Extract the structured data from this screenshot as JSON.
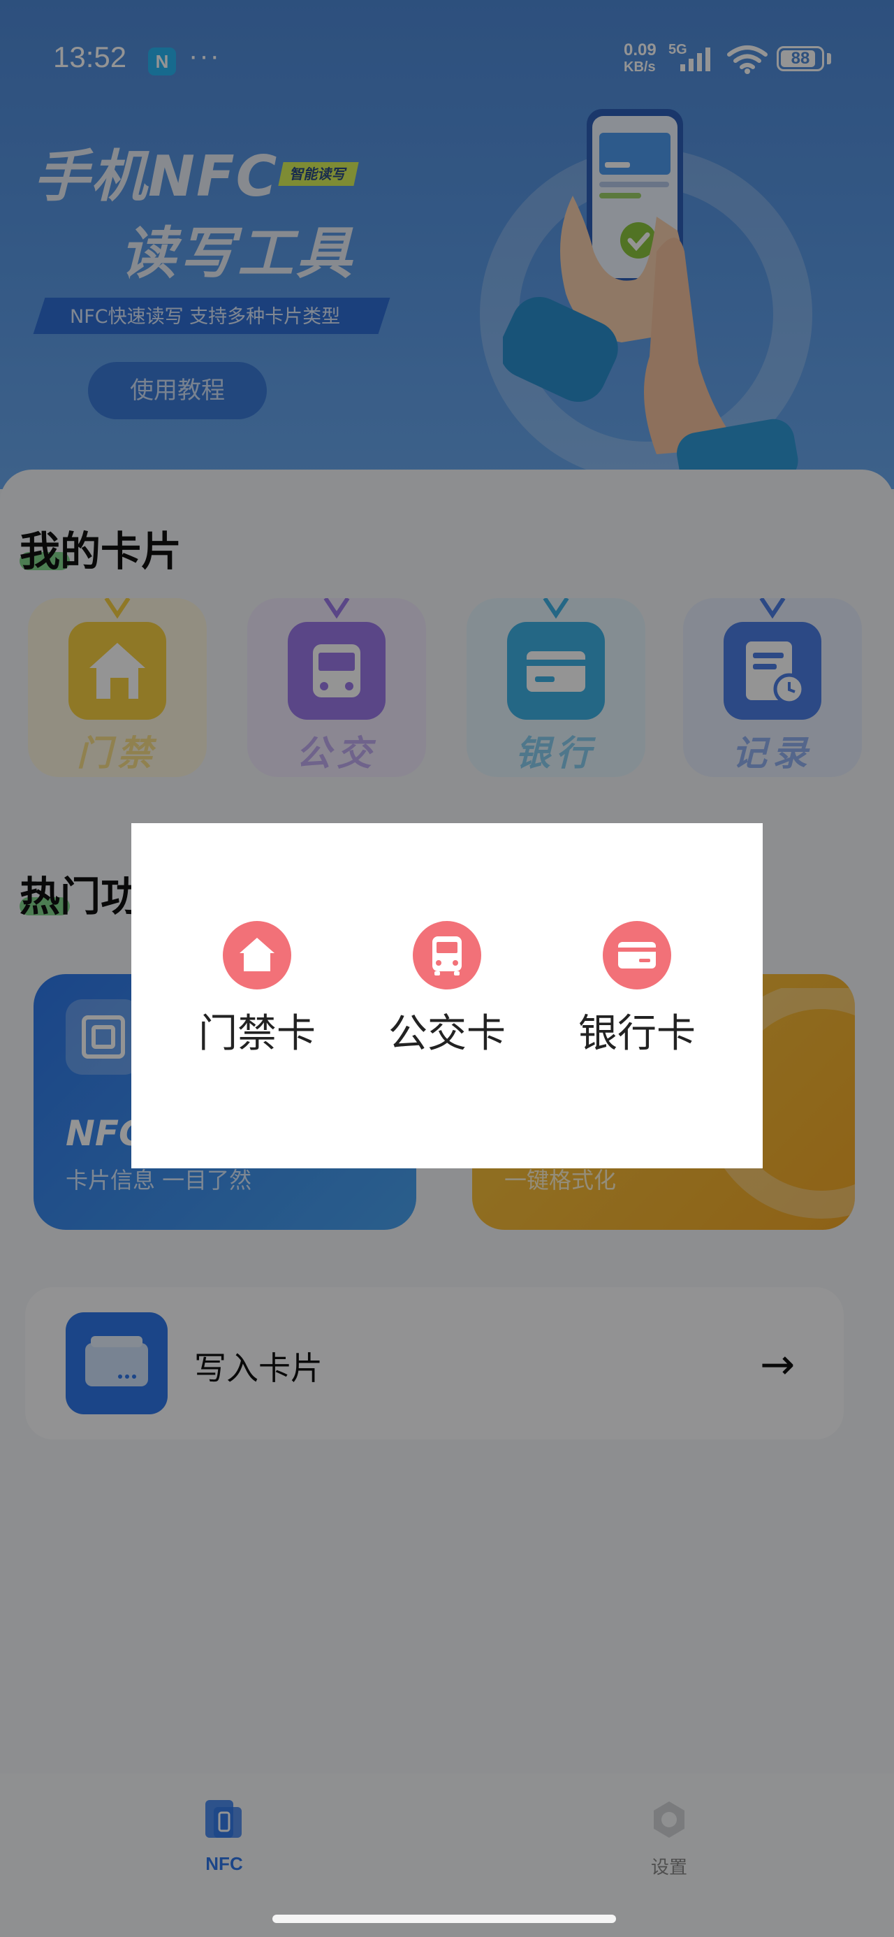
{
  "status_bar": {
    "time": "13:52",
    "nfc_badge": "N",
    "more": "···",
    "speed_value": "0.09",
    "speed_unit": "KB/s",
    "network": "5G",
    "battery": "88"
  },
  "banner": {
    "title_line1": "手机NFC",
    "tag": "智能读写",
    "title_line2": "读写工具",
    "subtitle": "NFC快速读写  支持多种卡片类型",
    "tutorial_button": "使用教程"
  },
  "my_cards": {
    "title": "我的卡片",
    "items": [
      {
        "label": "门禁",
        "color": "#f6cf43",
        "tile": "#fbf4de"
      },
      {
        "label": "公交",
        "color": "#9b79e8",
        "tile": "#efe9fb"
      },
      {
        "label": "银行",
        "color": "#3fb1e6",
        "tile": "#e4f3fb"
      },
      {
        "label": "记录",
        "color": "#4d7fe6",
        "tile": "#e6edfb"
      }
    ]
  },
  "hot": {
    "title": "热门功能",
    "left_card": {
      "title": "NFC卡片读取",
      "subtitle": "卡片信息  一目了然"
    },
    "right_card": {
      "subtitle": "一键格式化"
    }
  },
  "write_card": {
    "label": "写入卡片",
    "arrow": "→"
  },
  "bottom_nav": {
    "items": [
      {
        "label": "NFC",
        "active": true
      },
      {
        "label": "设置",
        "active": false
      }
    ]
  },
  "dialog": {
    "options": [
      {
        "label": "门禁卡",
        "icon": "home-icon"
      },
      {
        "label": "公交卡",
        "icon": "bus-icon"
      },
      {
        "label": "银行卡",
        "icon": "bank-card-icon"
      }
    ],
    "accent_color": "#f27178"
  }
}
